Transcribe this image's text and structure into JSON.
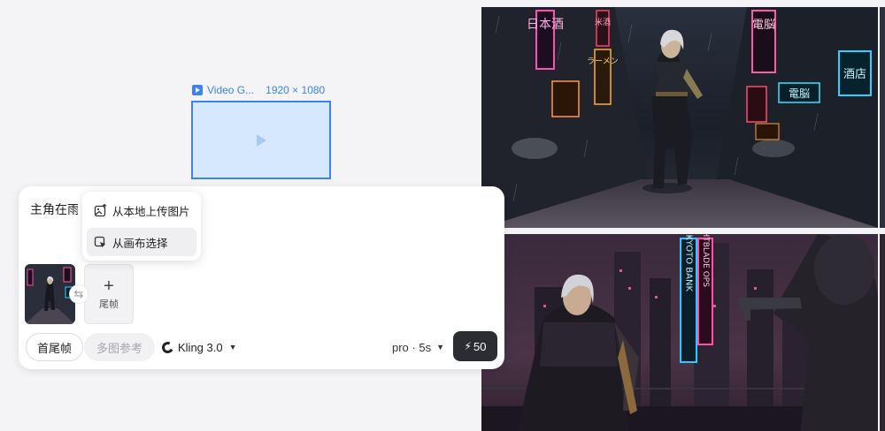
{
  "placeholder": {
    "title": "Video G...",
    "dimensions": "1920 × 1080",
    "icon": "video-icon"
  },
  "prompt": {
    "text": "主角在雨中奔跑，手持枪警戒"
  },
  "popover": {
    "upload_local": "从本地上传图片",
    "pick_canvas": "从画布选择"
  },
  "frames": {
    "end_frame_label": "尾帧",
    "swap_icon": "swap-icon"
  },
  "toolbar": {
    "first_last_frame": "首尾帧",
    "multi_ref": "多图参考",
    "model": "Kling 3.0",
    "quality": "pro · 5s",
    "credits": "50"
  },
  "canvas_images": {
    "top_signs": [
      "日本酒",
      "米酒",
      "ラーメン",
      "電脳",
      "酒店",
      "電脳"
    ],
    "bottom_signs": [
      "NEO-KYOTO BANK",
      "NIGHTBLADE OPS"
    ]
  },
  "colors": {
    "accent": "#3b82f6",
    "placeholder_fill": "#d6e8fd",
    "generate_button": "#2b2d33"
  }
}
